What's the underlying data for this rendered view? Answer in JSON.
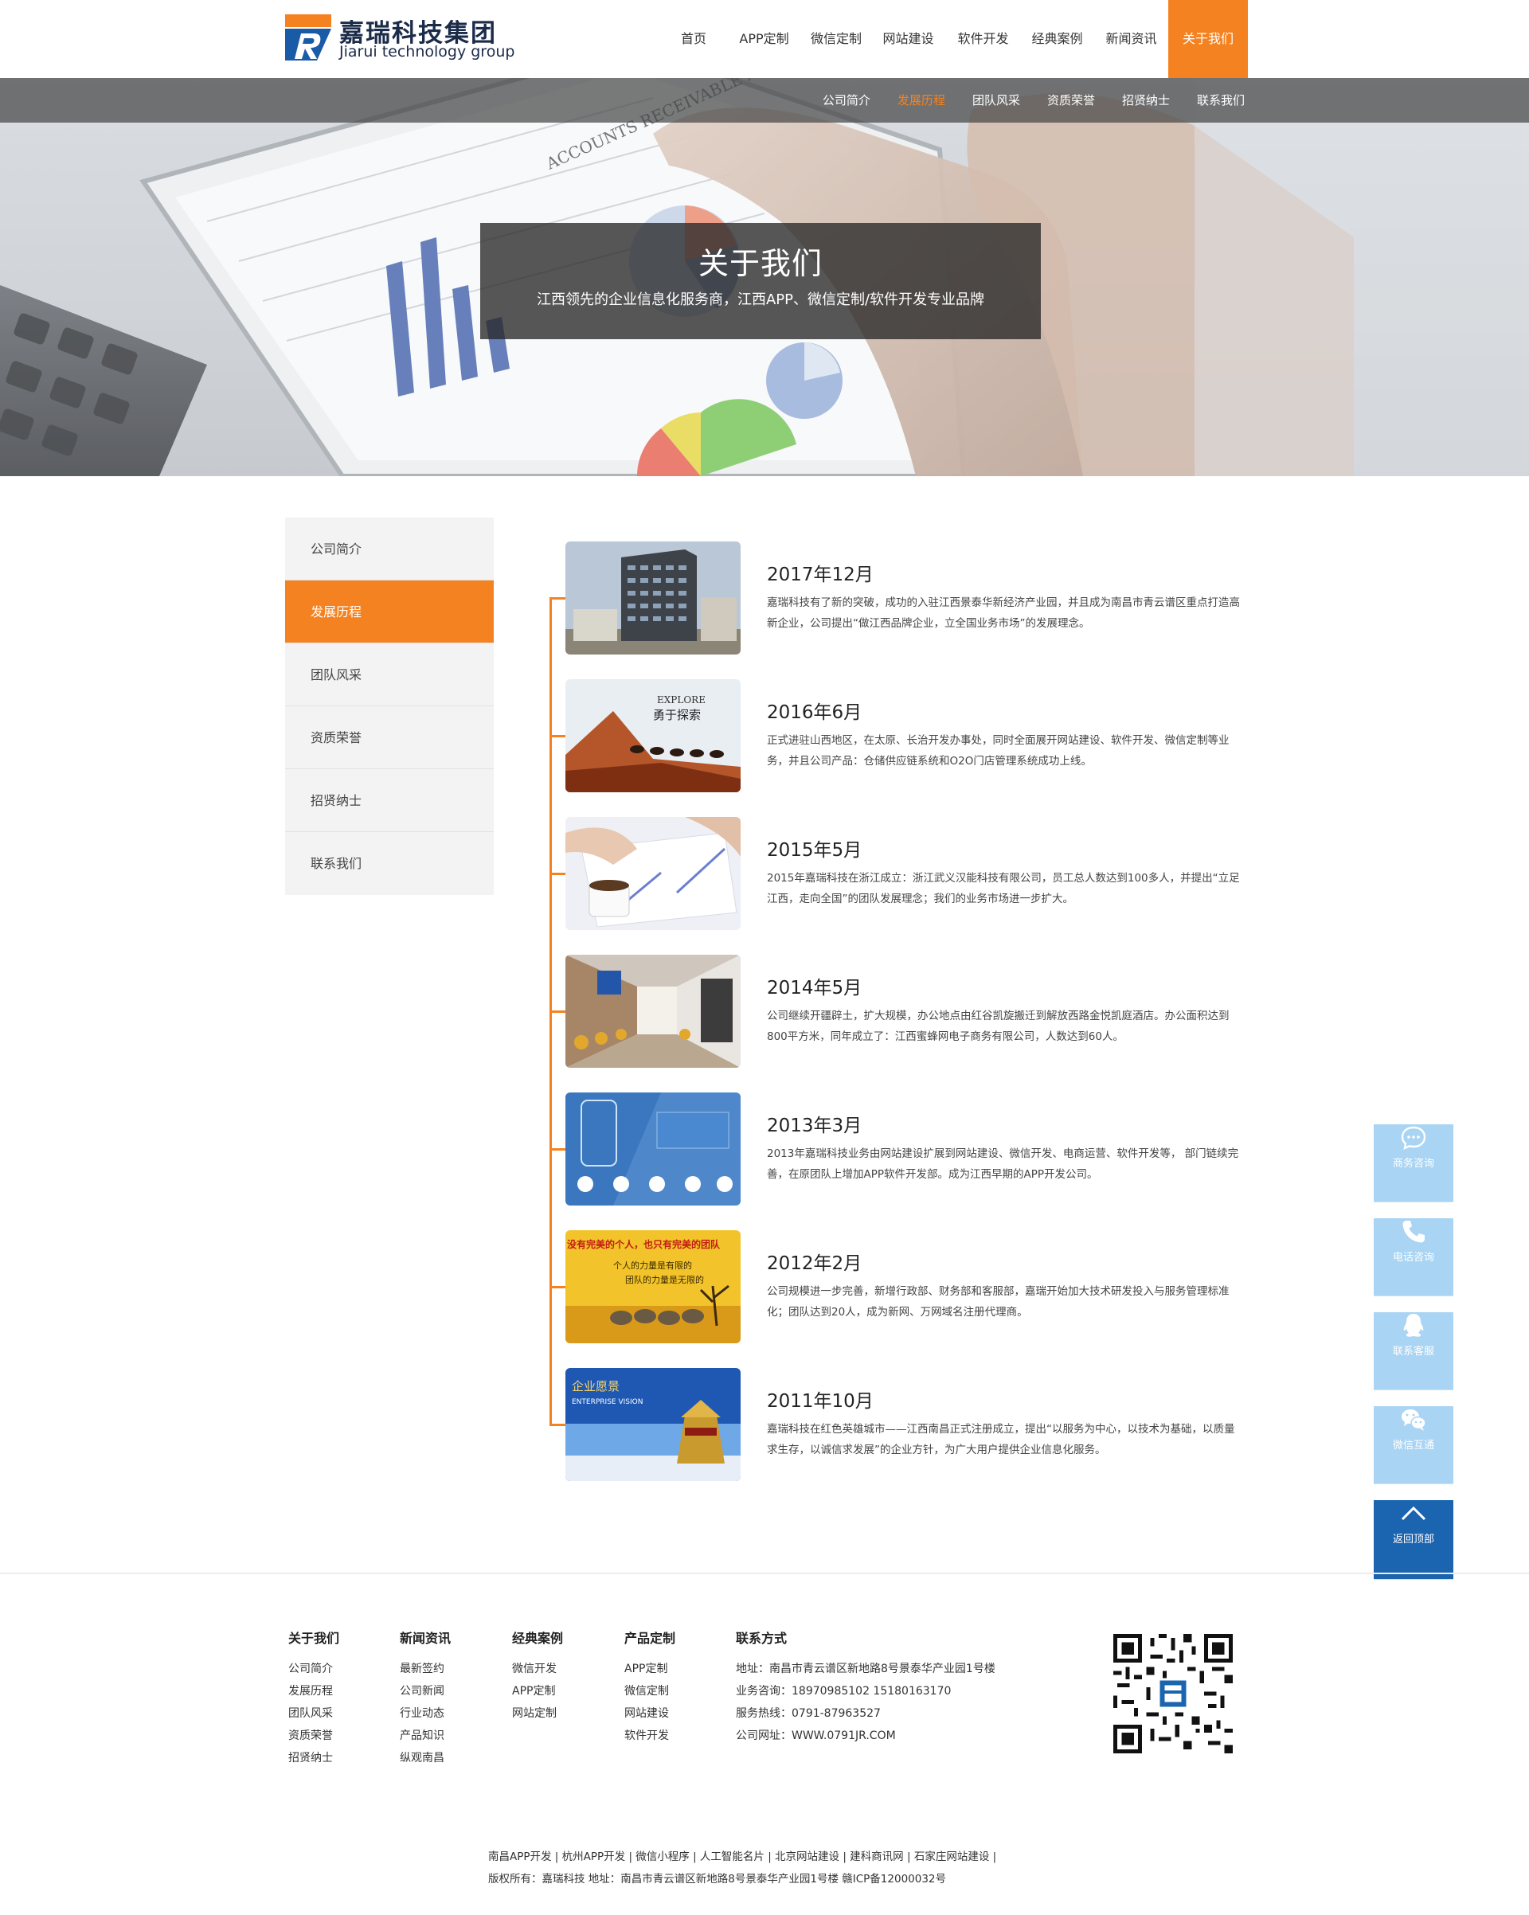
{
  "header": {
    "logo_cn": "嘉瑞科技集团",
    "logo_en": "Jiarui technology group",
    "nav": [
      {
        "label": "首页"
      },
      {
        "label": "APP定制"
      },
      {
        "label": "微信定制"
      },
      {
        "label": "网站建设"
      },
      {
        "label": "软件开发"
      },
      {
        "label": "经典案例"
      },
      {
        "label": "新闻资讯"
      },
      {
        "label": "关于我们",
        "active": true
      }
    ]
  },
  "banner": {
    "subnav": [
      {
        "label": "公司简介"
      },
      {
        "label": "发展历程",
        "active": true
      },
      {
        "label": "团队风采"
      },
      {
        "label": "资质荣誉"
      },
      {
        "label": "招贤纳士"
      },
      {
        "label": "联系我们"
      }
    ],
    "title": "关于我们",
    "subtitle": "江西领先的企业信息化服务商，江西APP、微信定制/软件开发专业品牌",
    "graphic_text": [
      "ACCOUNTS RECEIVABLE AGING"
    ]
  },
  "sidebar": {
    "items": [
      {
        "label": "公司简介"
      },
      {
        "label": "发展历程",
        "active": true
      },
      {
        "label": "团队风采"
      },
      {
        "label": "资质荣誉"
      },
      {
        "label": "招贤纳士"
      },
      {
        "label": "联系我们"
      }
    ]
  },
  "timeline": [
    {
      "date": "2017年12月",
      "text": "嘉瑞科技有了新的突破，成功的入驻江西景泰华新经济产业园，并且成为南昌市青云谱区重点打造高新企业，公司提出“做江西品牌企业，立全国业务市场”的发展理念。",
      "image": "office-building"
    },
    {
      "date": "2016年6月",
      "text": "正式进驻山西地区，在太原、长治开发办事处，同时全面展开网站建设、软件开发、微信定制等业务，并且公司产品：仓储供应链系统和O2O门店管理系统成功上线。",
      "image": "desert-camels",
      "image_text": [
        "EXPLORE",
        "勇于探索"
      ]
    },
    {
      "date": "2015年5月",
      "text": "2015年嘉瑞科技在浙江成立：浙江武义汉能科技有限公司，员工总人数达到100多人，并提出“立足江西，走向全国”的团队发展理念；我们的业务市场进一步扩大。",
      "image": "desk-coffee"
    },
    {
      "date": "2014年5月",
      "text": "公司继续开疆辟土，扩大规模，办公地点由红谷凯旋搬迁到解放西路金悦凯庭酒店。办公面积达到800平方米，同年成立了：江西蜜蜂网电子商务有限公司，人数达到60人。",
      "image": "office-corridor"
    },
    {
      "date": "2013年3月",
      "text": "2013年嘉瑞科技业务由网站建设扩展到网站建设、微信开发、电商运营、软件开发等， 部门链续完善，在原团队上增加APP软件开发部。成为江西早期的APP开发公司。",
      "image": "app-ui"
    },
    {
      "date": "2012年2月",
      "text": "公司规模进一步完善，新增行政部、财务部和客服部，嘉瑞开始加大技术研发投入与服务管理标准化；团队达到20人，成为新网、万网域名注册代理商。",
      "image": "wolf-team",
      "image_text": [
        "没有完美的个人，也只有完美的团队",
        "个人的力量是有限的",
        "团队的力量是无限的"
      ]
    },
    {
      "date": "2011年10月",
      "text": "嘉瑞科技在红色英雄城市——江西南昌正式注册成立，提出“以服务为中心，以技术为基础，以质量求生存，以诚信求发展”的企业方针，为广大用户提供企业信息化服务。",
      "image": "enterprise-vision",
      "image_text": [
        "企业愿景",
        "ENTERPRISE VISION"
      ]
    }
  ],
  "floatbar": [
    {
      "label": "商务咨询",
      "icon": "chat-icon"
    },
    {
      "label": "电话咨询",
      "icon": "phone-icon"
    },
    {
      "label": "联系客服",
      "icon": "qq-icon"
    },
    {
      "label": "微信互通",
      "icon": "wechat-icon"
    },
    {
      "label": "返回顶部",
      "icon": "arrow-up-icon"
    }
  ],
  "footer": {
    "columns": [
      {
        "title": "关于我们",
        "items": [
          "公司简介",
          "发展历程",
          "团队风采",
          "资质荣誉",
          "招贤纳士"
        ]
      },
      {
        "title": "新闻资讯",
        "items": [
          "最新签约",
          "公司新闻",
          "行业动态",
          "产品知识",
          "纵观南昌"
        ]
      },
      {
        "title": "经典案例",
        "items": [
          "微信开发",
          "APP定制",
          "网站定制"
        ]
      },
      {
        "title": "产品定制",
        "items": [
          "APP定制",
          "微信定制",
          "网站建设",
          "软件开发"
        ]
      },
      {
        "title": "联系方式",
        "items": [
          "地址：南昌市青云谱区新地路8号景泰华产业园1号楼",
          "业务咨询：18970985102 15180163170",
          "服务热线：0791-87963527",
          "公司网址：WWW.0791JR.COM"
        ]
      }
    ],
    "links_line": "南昌APP开发 | 杭州APP开发 | 微信小程序 | 人工智能名片 | 北京网站建设 | 建科商讯网 | 石家庄网站建设 |",
    "copyright_line": "版权所有：嘉瑞科技    地址：南昌市青云谱区新地路8号景泰华产业园1号楼    赣ICP备12000032号"
  },
  "colors": {
    "accent": "#f58220",
    "float_bar": "#a9d4f3",
    "float_top": "#1a64b0"
  }
}
